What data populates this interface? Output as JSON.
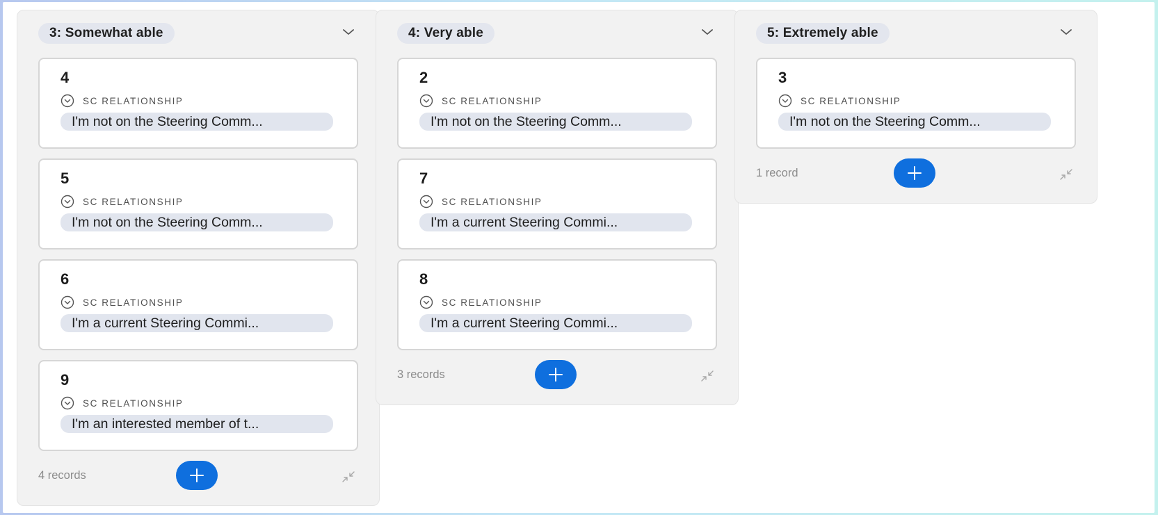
{
  "field_label": "SC RELATIONSHIP",
  "colors": {
    "accent": "#0f6fde",
    "column_bg": "#f2f2f2",
    "pill_bg": "#e1e5ee"
  },
  "icons": {
    "column_toggle": "chevron-down-icon",
    "field_type": "circle-chevron-icon",
    "add": "plus-icon",
    "collapse": "collapse-arrows-icon"
  },
  "columns": [
    {
      "title": "3: Somewhat able",
      "record_count": "4 records",
      "cards": [
        {
          "title": "4",
          "value": "I'm not on the Steering Comm..."
        },
        {
          "title": "5",
          "value": "I'm not on the Steering Comm..."
        },
        {
          "title": "6",
          "value": "I'm a current Steering Commi..."
        },
        {
          "title": "9",
          "value": "I'm an interested member of t..."
        }
      ]
    },
    {
      "title": "4: Very able",
      "record_count": "3 records",
      "cards": [
        {
          "title": "2",
          "value": "I'm not on the Steering Comm..."
        },
        {
          "title": "7",
          "value": "I'm a current Steering Commi..."
        },
        {
          "title": "8",
          "value": "I'm a current Steering Commi..."
        }
      ]
    },
    {
      "title": "5: Extremely able",
      "record_count": "1 record",
      "cards": [
        {
          "title": "3",
          "value": "I'm not on the Steering Comm..."
        }
      ]
    }
  ]
}
